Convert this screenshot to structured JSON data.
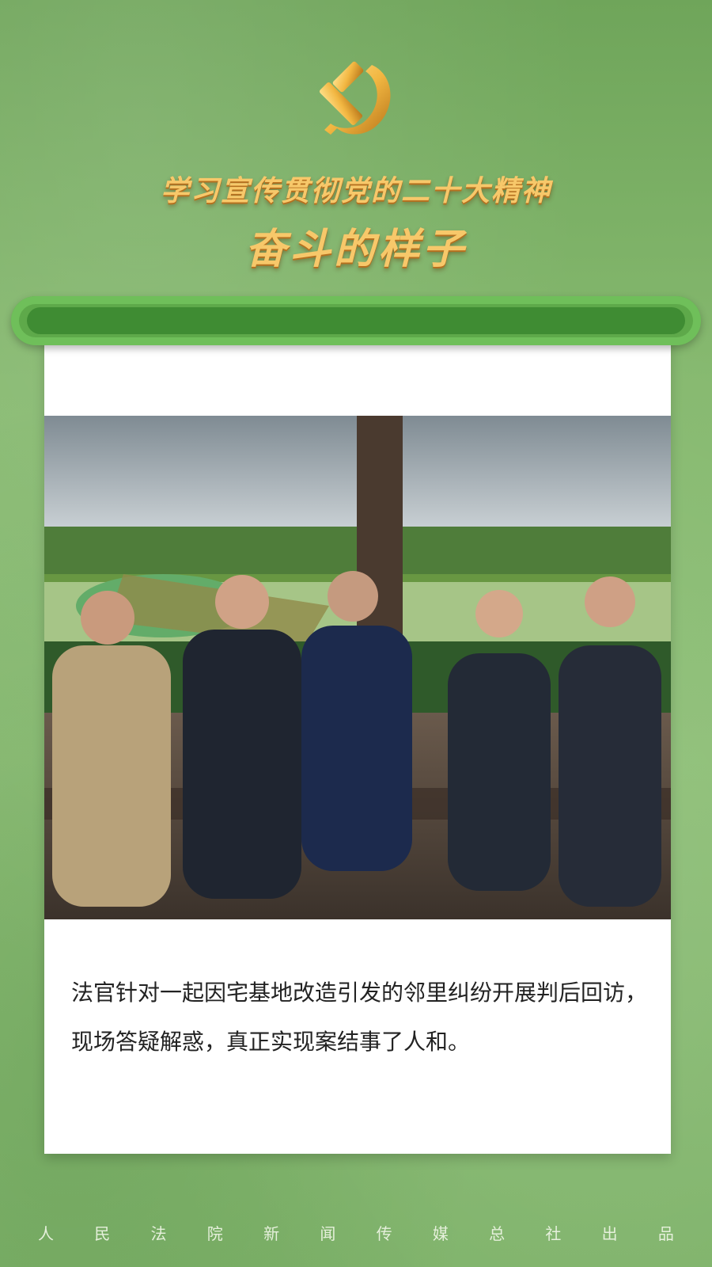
{
  "header": {
    "line1": "学习宣传贯彻党的二十大精神",
    "line2": "奋斗的样子"
  },
  "emblem": {
    "icon": "hammer-sickle-icon",
    "color": "#f2b742"
  },
  "photo": {
    "description_icon": "outdoor-pavilion-photo"
  },
  "caption": "法官针对一起因宅基地改造引发的邻里纠纷开展判后回访，现场答疑解惑，真正实现案结事了人和。",
  "footer": {
    "chars": [
      "人",
      "民",
      "法",
      "院",
      "新",
      "闻",
      "传",
      "媒",
      "总",
      "社",
      "出",
      "品"
    ]
  },
  "colors": {
    "background": "#86b96f",
    "title_gold": "#f7c86a",
    "rod_green": "#5ea94a"
  }
}
